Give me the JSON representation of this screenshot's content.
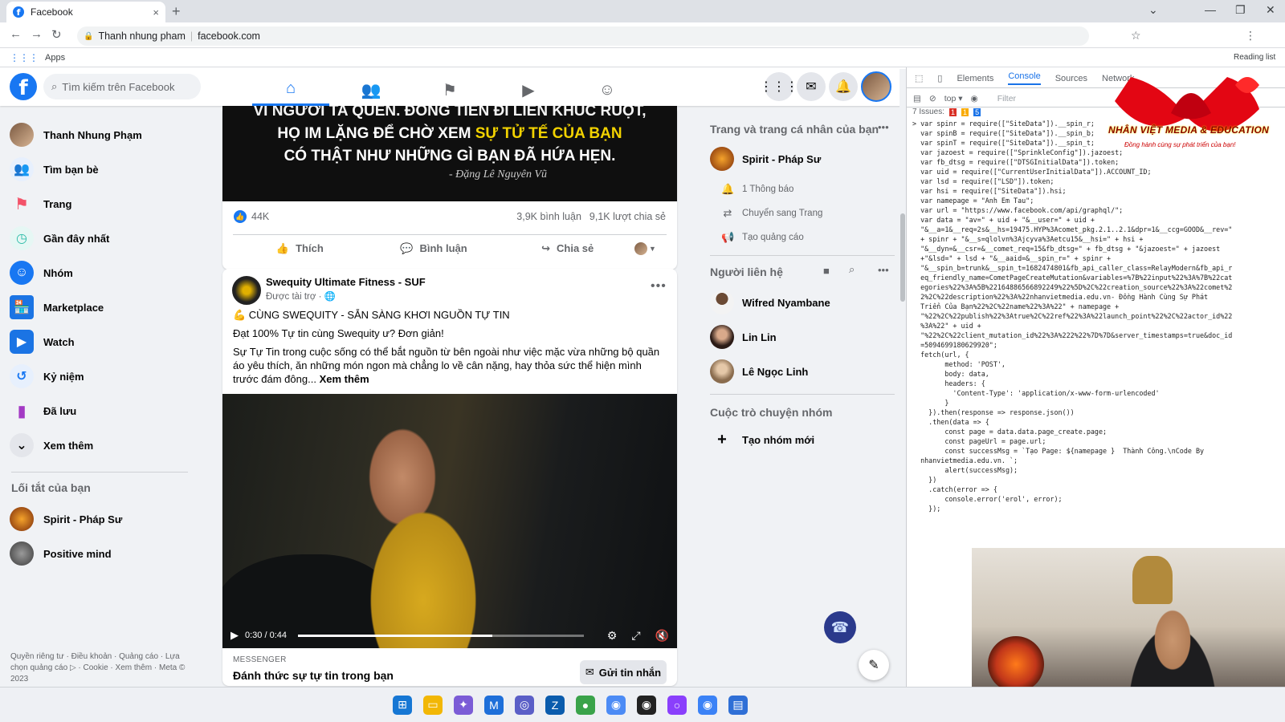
{
  "browser": {
    "tab_title": "Facebook",
    "tab_close": "×",
    "new_tab": "+",
    "profile_name": "Thanh nhung pham",
    "url": "facebook.com",
    "bookmarks_apps": "Apps",
    "reading_list": "Reading list"
  },
  "fb_header": {
    "search_placeholder": "Tìm kiếm trên Facebook",
    "logo_letter": "f"
  },
  "left_sidebar": {
    "items": [
      {
        "label": "Thanh Nhung Phạm",
        "icon": "avatar"
      },
      {
        "label": "Tìm bạn bè",
        "icon": "friends-icon",
        "color": "#1877f2"
      },
      {
        "label": "Trang",
        "icon": "flag-icon",
        "color": "#f35369"
      },
      {
        "label": "Gần đây nhất",
        "icon": "clock-feed-icon",
        "color": "#2abba7"
      },
      {
        "label": "Nhóm",
        "icon": "groups-icon",
        "color": "#1877f2"
      },
      {
        "label": "Marketplace",
        "icon": "shop-icon",
        "color": "#1b74e4"
      },
      {
        "label": "Watch",
        "icon": "play-icon",
        "color": "#1b74e4"
      },
      {
        "label": "Kỷ niệm",
        "icon": "memories-icon",
        "color": "#1877f2"
      },
      {
        "label": "Đã lưu",
        "icon": "bookmark-icon",
        "color": "#a33ac4"
      },
      {
        "label": "Xem thêm",
        "icon": "chevron-down-icon",
        "color": "#e4e6eb"
      }
    ],
    "shortcuts_title": "Lối tắt của bạn",
    "shortcuts": [
      {
        "label": "Spirit - Pháp Sư"
      },
      {
        "label": "Positive mind"
      }
    ],
    "footer": "Quyền riêng tư · Điều khoản · Quảng cáo · Lựa chọn quảng cáo ▷ · Cookie · Xem thêm · Meta © 2023"
  },
  "post1": {
    "quote_line1": "VÌ NGƯỜI TA QUÊN. ĐỒNG TIỀN ĐI LIỀN KHÚC RUỘT,",
    "quote_line2_a": "HỌ IM LẶNG ĐỂ CHỜ XEM ",
    "quote_line2_b": "SỰ TỬ TẾ CỦA BẠN",
    "quote_line3_a": "CÓ THẬT NHƯ NHỮNG GÌ BẠN ĐÃ HỨA HẸN.",
    "quote_signature": "- Đặng Lê Nguyên Vũ",
    "likes": "44K",
    "comments": "3,9K bình luận",
    "shares": "9,1K lượt chia sẻ",
    "like_label": "Thích",
    "comment_label": "Bình luận",
    "share_label": "Chia sẻ"
  },
  "post2": {
    "page_name": "Swequity Ultimate Fitness - SUF",
    "sponsored": "Được tài trợ · ",
    "headline": "💪 CÙNG SWEQUITY - SẴN SÀNG KHƠI NGUỒN TỰ TIN",
    "line2": "Đạt 100% Tự tin cùng Swequity ư? Đơn giản!",
    "body": "Sự Tự Tin trong cuộc sống có thể bắt nguồn từ bên ngoài như việc mặc vừa những bộ quần áo yêu thích, ăn những món ngon mà chẳng lo về cân nặng, hay thỏa sức thể hiện mình trước đám đông...",
    "see_more": "Xem thêm",
    "video_time": "0:30 / 0:44",
    "video_progress_fraction": 0.68,
    "footer_label": "MESSENGER",
    "footer_title": "Đánh thức sự tự tin trong bạn",
    "send_button": "Gửi tin nhắn"
  },
  "right_col": {
    "pages_title": "Trang và trang cá nhân của bạn",
    "page_name": "Spirit - Pháp Sư",
    "page_actions": [
      {
        "label": "1 Thông báo",
        "icon": "bell-icon"
      },
      {
        "label": "Chuyển sang Trang",
        "icon": "switch-icon"
      },
      {
        "label": "Tạo quảng cáo",
        "icon": "megaphone-icon"
      }
    ],
    "contacts_title": "Người liên hệ",
    "contacts": [
      {
        "name": "Wifred Nyambane"
      },
      {
        "name": "Lin Lin"
      },
      {
        "name": "Lê Ngọc Linh"
      }
    ],
    "groups_title": "Cuộc trò chuyện nhóm",
    "new_group": "Tạo nhóm mới"
  },
  "devtools": {
    "tabs": [
      "Elements",
      "Console",
      "Sources",
      "Network"
    ],
    "active_tab": "Console",
    "context": "top ▾",
    "filter_placeholder": "Filter",
    "issues_label": "7 Issues:",
    "issues_red": "1",
    "issues_yellow": "1",
    "issues_blue": "5",
    "console_lines": [
      "> var spinr = require([\"SiteData\"]).__spin_r;",
      "  var spinB = require([\"SiteData\"]).__spin_b;",
      "  var spinT = require([\"SiteData\"]).__spin_t;",
      "  var jazoest = require([\"SprinkleConfig\"]).jazoest;",
      "  var fb_dtsg = require([\"DTSGInitialData\"]).token;",
      "  var uid = require([\"CurrentUserInitialData\"]).ACCOUNT_ID;",
      "  var lsd = require([\"LSD\"]).token;",
      "  var hsi = require([\"SiteData\"]).hsi;",
      "  var namepage = \"Anh Em Tau\";",
      "  var url = \"https://www.facebook.com/api/graphql/\";",
      "  var data = \"av=\" + uid + \"&__user=\" + uid +",
      "  \"&__a=1&__req=2s&__hs=19475.HYP%3Acomet_pkg.2.1..2.1&dpr=1&__ccg=GOOD&__rev=\"",
      "  + spinr + \"&__s=qlolvn%3Ajcyva%3Aetcu15&__hsi=\" + hsi +",
      "  \"&__dyn=&__csr=&__comet_req=15&fb_dtsg=\" + fb_dtsg + \"&jazoest=\" + jazoest",
      "  +\"&lsd=\" + lsd + \"&__aaid=&__spin_r=\" + spinr +",
      "  \"&__spin_b=trunk&__spin_t=1682474801&fb_api_caller_class=RelayModern&fb_api_r",
      "  eq_friendly_name=CometPageCreateMutation&variables=%7B%22input%22%3A%7B%22cat",
      "  egories%22%3A%5B%22164886566892249%22%5D%2C%22creation_source%22%3A%22comet%2",
      "  2%2C%22description%22%3A%22nhanvietmedia.edu.vn- Đồng Hành Cùng Sự Phát",
      "  Triển Của Bạn%22%2C%22name%22%3A%22\" + namepage +",
      "  \"%22%2C%22publish%22%3Atrue%2C%22ref%22%3A%22launch_point%22%2C%22actor_id%22",
      "  %3A%22\" + uid +",
      "  \"%22%2C%22client_mutation_id%22%3A%222%22%7D%7D&server_timestamps=true&doc_id",
      "  =5094699180629920\";",
      "  fetch(url, {",
      "        method: 'POST',",
      "        body: data,",
      "        headers: {",
      "          'Content-Type': 'application/x-www-form-urlencoded'",
      "        }",
      "    }).then(response => response.json())",
      "    .then(data => {",
      "        const page = data.data.page_create.page;",
      "        const pageUrl = page.url;",
      "        const successMsg = `Tạo Page: ${namepage }  Thành Công.\\nCode By",
      "  nhanvietmedia.edu.vn. `;",
      "        alert(successMsg);",
      "    })",
      "    .catch(error => {",
      "        console.error('erol', error);",
      "    });"
    ]
  },
  "logo": {
    "title": "NHÂN VIỆT MEDIA & EDUCATION",
    "subtitle": "Đồng hành cùng sự phát triển của bạn!"
  },
  "colors": {
    "fb_blue": "#1877f2",
    "page_bg": "#f0f2f5",
    "devtools_accent": "#1a73e8"
  }
}
